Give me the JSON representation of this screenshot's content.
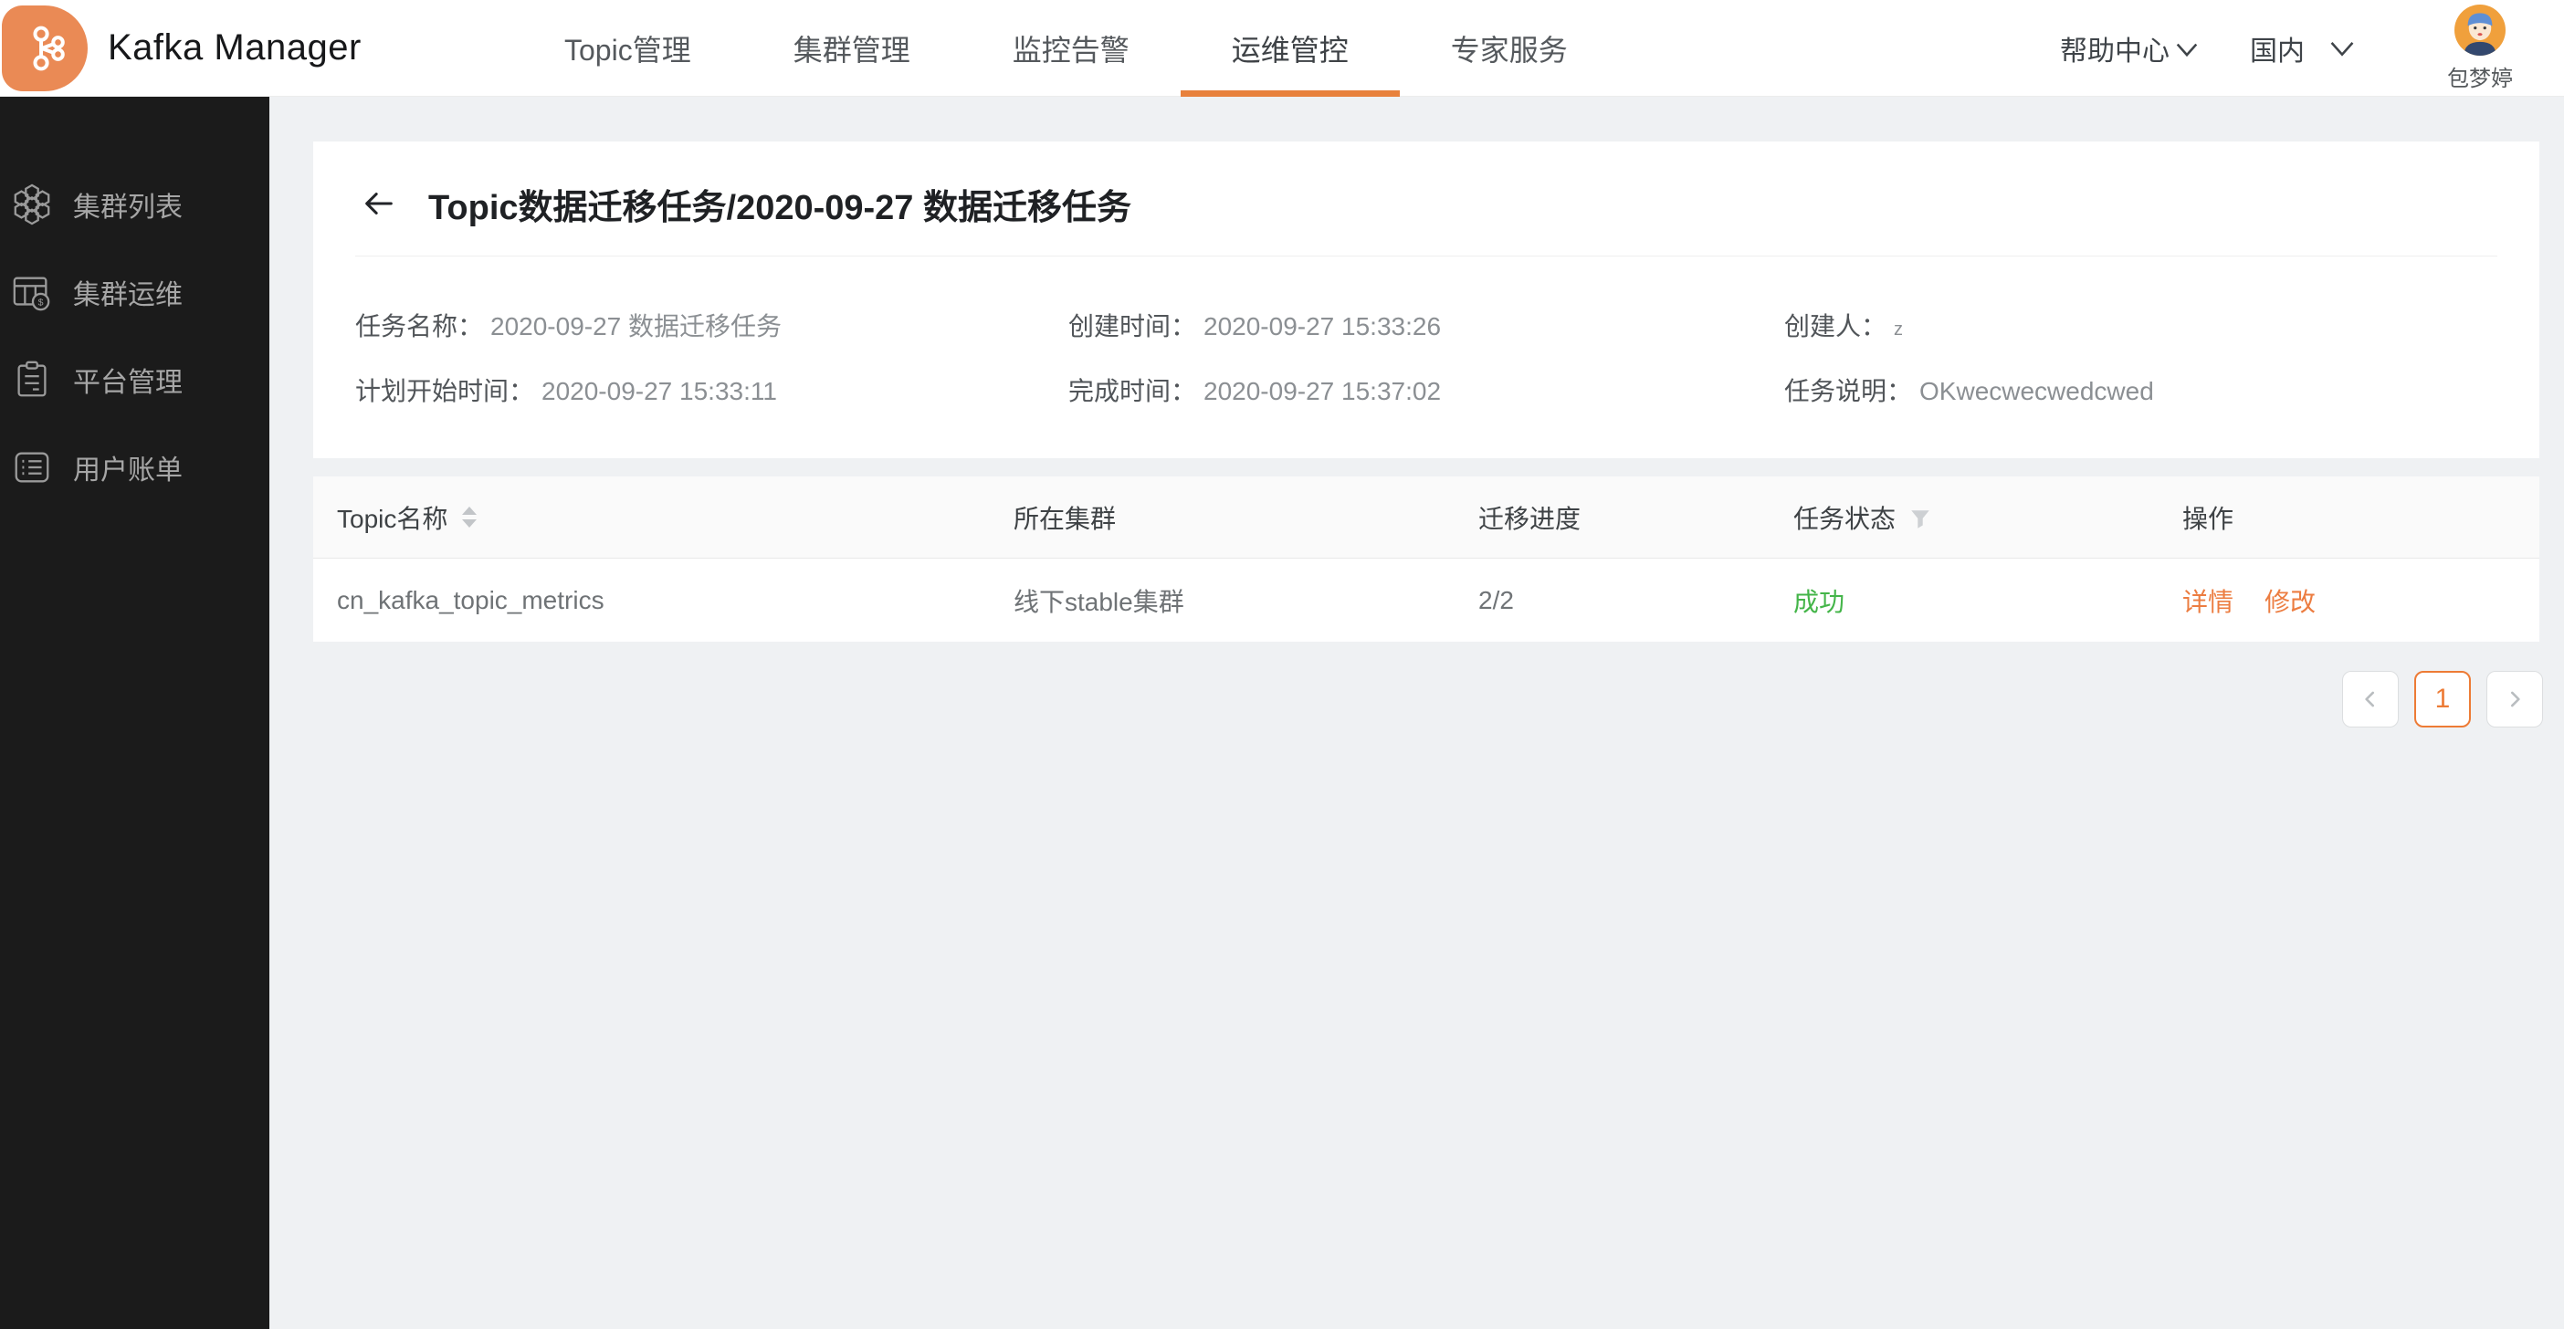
{
  "header": {
    "app_title": "Kafka Manager",
    "nav": [
      {
        "label": "Topic管理",
        "active": false
      },
      {
        "label": "集群管理",
        "active": false
      },
      {
        "label": "监控告警",
        "active": false
      },
      {
        "label": "运维管控",
        "active": true
      },
      {
        "label": "专家服务",
        "active": false
      }
    ],
    "help_label": "帮助中心",
    "region_label": "国内",
    "user_name": "包梦婷"
  },
  "sidebar": {
    "items": [
      {
        "label": "集群列表",
        "icon": "honeycomb-cluster-icon"
      },
      {
        "label": "集群运维",
        "icon": "table-billing-icon"
      },
      {
        "label": "平台管理",
        "icon": "clipboard-icon"
      },
      {
        "label": "用户账单",
        "icon": "list-bill-icon"
      }
    ]
  },
  "page": {
    "title": "Topic数据迁移任务/2020-09-27 数据迁移任务",
    "fields": [
      {
        "label": "任务名称：",
        "value": "2020-09-27 数据迁移任务"
      },
      {
        "label": "创建时间：",
        "value": "2020-09-27 15:33:26"
      },
      {
        "label": "创建人：",
        "value": "z"
      },
      {
        "label": "计划开始时间：",
        "value": "2020-09-27 15:33:11"
      },
      {
        "label": "完成时间：",
        "value": "2020-09-27 15:37:02"
      },
      {
        "label": "任务说明：",
        "value": "OKwecwecwedcwed"
      }
    ]
  },
  "table": {
    "columns": [
      "Topic名称",
      "所在集群",
      "迁移进度",
      "任务状态",
      "操作"
    ],
    "rows": [
      {
        "topic": "cn_kafka_topic_metrics",
        "cluster": "线下stable集群",
        "progress": "2/2",
        "status": "成功",
        "actions": [
          "详情",
          "修改"
        ]
      }
    ]
  },
  "pagination": {
    "current": "1"
  },
  "colors": {
    "accent_orange": "#E8813C",
    "link_orange": "#EC7D41",
    "success_green": "#44B549",
    "sidebar_bg": "#1B1B1B",
    "page_bg": "#EFF1F3"
  }
}
